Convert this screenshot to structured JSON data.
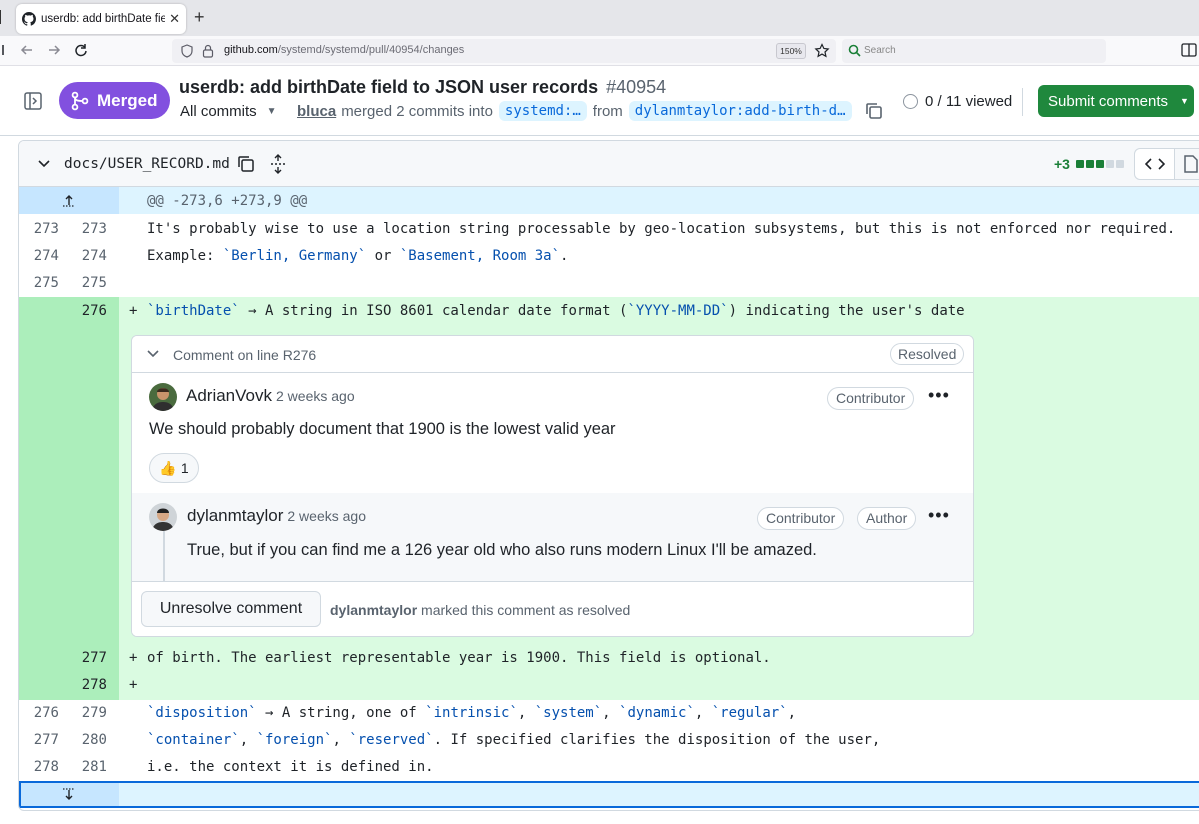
{
  "browser": {
    "tab_title": "userdb: add birthDate field to",
    "new_tab": "+",
    "url_host": "github.com",
    "url_path": "/systemd/systemd/pull/40954/changes",
    "zoom": "150%",
    "search_placeholder": "Search"
  },
  "pr": {
    "state": "Merged",
    "title": "userdb: add birthDate field to JSON user records",
    "number": "#40954",
    "commits_filter": "All commits",
    "merged_by": "bluca",
    "merge_text": "merged 2 commits into",
    "base_branch": "systemd:…",
    "from_text": "from",
    "head_branch": "dylanmtaylor:add-birth-d…",
    "viewed": "0 / 11 viewed",
    "submit_label": "Submit comments"
  },
  "file": {
    "name": "docs/USER_RECORD.md",
    "additions": "+3"
  },
  "diff": {
    "hunk_header": "@@ -273,6 +273,9 @@",
    "ctx1": {
      "old": "273",
      "new": "273",
      "text": "It's probably wise to use a location string processable by geo-location subsystems, but this is not enforced nor required."
    },
    "ctx2": {
      "old": "274",
      "new": "274",
      "pre": "Example: ",
      "t1": "`Berlin, Germany`",
      "mid": " or ",
      "t2": "`Basement, Room 3a`",
      "post": "."
    },
    "ctx3": {
      "old": "275",
      "new": "275"
    },
    "add1": {
      "new": "276",
      "sign": "+",
      "t1": "`birthDate`",
      "rest1": " → A string in ISO 8601 calendar date format (",
      "t2": "`YYYY-MM-DD`",
      "rest2": ") indicating the user's date"
    },
    "add2": {
      "new": "277",
      "sign": "+",
      "text": "of birth. The earliest representable year is 1900. This field is optional."
    },
    "add3": {
      "new": "278",
      "sign": "+"
    },
    "ctx4": {
      "old": "276",
      "new": "279",
      "t1": "`disposition`",
      "r1": " → A string, one of ",
      "t2": "`intrinsic`",
      "c1": ", ",
      "t3": "`system`",
      "c2": ", ",
      "t4": "`dynamic`",
      "c3": ", ",
      "t5": "`regular`",
      "c4": ","
    },
    "ctx5": {
      "old": "277",
      "new": "280",
      "t1": "`container`",
      "c1": ", ",
      "t2": "`foreign`",
      "c2": ", ",
      "t3": "`reserved`",
      "rest": ". If specified clarifies the disposition of the user,"
    },
    "ctx6": {
      "old": "278",
      "new": "281",
      "text": "i.e. the context it is defined in."
    }
  },
  "thread": {
    "header": "Comment on line R276",
    "resolved_label": "Resolved",
    "comments": [
      {
        "author": "AdrianVovk",
        "time": "2 weeks ago",
        "badge": "Contributor",
        "body": "We should probably document that 1900 is the lowest valid year",
        "reaction": "👍",
        "reaction_count": "1"
      },
      {
        "author": "dylanmtaylor",
        "time": "2 weeks ago",
        "badge": "Contributor",
        "badge2": "Author",
        "body": "True, but if you can find me a 126 year old who also runs modern Linux I'll be amazed."
      }
    ],
    "unresolve_label": "Unresolve comment",
    "resolved_by": "dylanmtaylor",
    "resolved_text": "marked this comment as resolved"
  },
  "colors": {
    "merged": "#8250df",
    "submit": "#1f883d",
    "addition_bg": "#dafbe1",
    "addition_gutter": "#aceebb",
    "hunk_bg": "#ddf4ff"
  }
}
